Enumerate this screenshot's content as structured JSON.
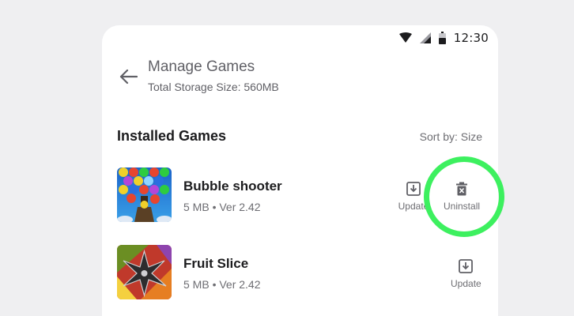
{
  "status_bar": {
    "time": "12:30"
  },
  "header": {
    "title": "Manage Games",
    "subtitle": "Total Storage Size: 560MB"
  },
  "section": {
    "title": "Installed Games",
    "sort_label": "Sort by: Size"
  },
  "games": [
    {
      "name": "Bubble shooter",
      "meta": "5 MB • Ver 2.42",
      "update_label": "Update",
      "uninstall_label": "Uninstall"
    },
    {
      "name": "Fruit Slice",
      "meta": "5 MB • Ver 2.42",
      "update_label": "Update"
    }
  ],
  "colors": {
    "highlight": "#3df05f",
    "background": "#efeff1",
    "card": "#ffffff"
  },
  "icons": [
    "wifi-icon",
    "signal-icon",
    "battery-icon",
    "back-arrow-icon",
    "download-icon",
    "trash-icon"
  ]
}
